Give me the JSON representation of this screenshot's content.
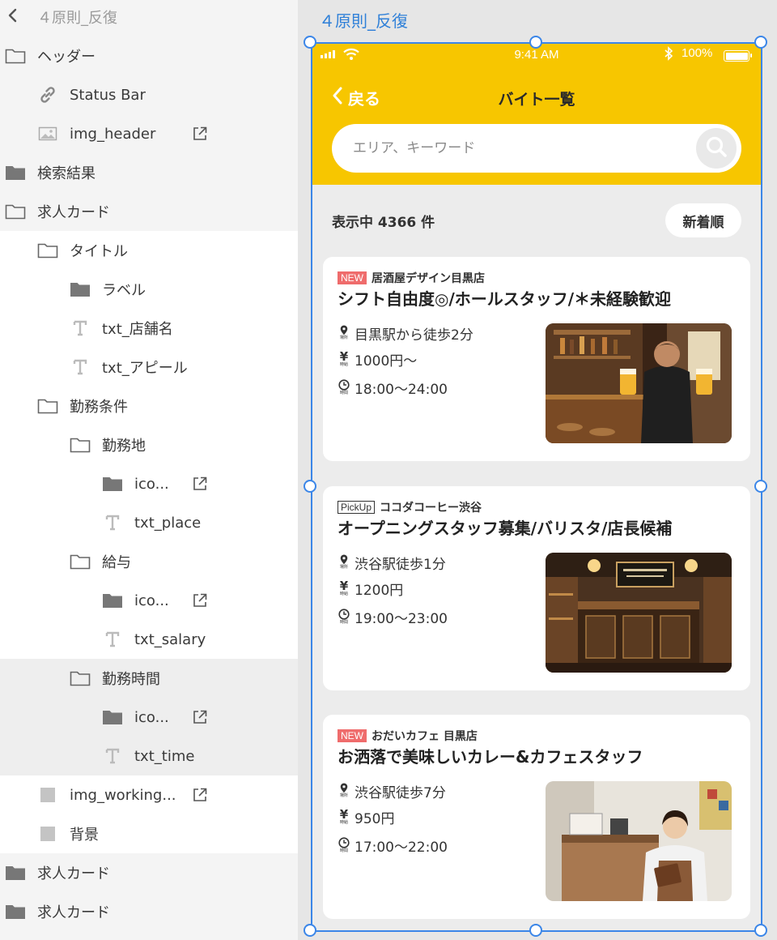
{
  "layers": {
    "back_label": "４原則_反復",
    "items": [
      {
        "label": "ヘッダー",
        "icon": "folder-outline"
      },
      {
        "label": "Status Bar",
        "icon": "link"
      },
      {
        "label": "img_header",
        "icon": "image"
      },
      {
        "label": "検索結果",
        "icon": "folder-filled"
      },
      {
        "label": "求人カード",
        "icon": "folder-outline"
      },
      {
        "label": "タイトル",
        "icon": "folder-outline"
      },
      {
        "label": "ラベル",
        "icon": "folder-filled"
      },
      {
        "label": "txt_店舗名",
        "icon": "text"
      },
      {
        "label": "txt_アピール",
        "icon": "text"
      },
      {
        "label": "勤務条件",
        "icon": "folder-outline"
      },
      {
        "label": "勤務地",
        "icon": "folder-outline"
      },
      {
        "label": "ico...",
        "icon": "folder-filled"
      },
      {
        "label": "txt_place",
        "icon": "text"
      },
      {
        "label": "給与",
        "icon": "folder-outline"
      },
      {
        "label": "ico...",
        "icon": "folder-filled"
      },
      {
        "label": "txt_salary",
        "icon": "text"
      },
      {
        "label": "勤務時間",
        "icon": "folder-outline"
      },
      {
        "label": "ico...",
        "icon": "folder-filled"
      },
      {
        "label": "txt_time",
        "icon": "text"
      },
      {
        "label": "img_working...",
        "icon": "rect"
      },
      {
        "label": "背景",
        "icon": "rect"
      },
      {
        "label": "求人カード",
        "icon": "folder-filled"
      },
      {
        "label": "求人カード",
        "icon": "folder-filled"
      }
    ]
  },
  "canvas": {
    "artboard_title": "４原則_反復"
  },
  "app": {
    "status": {
      "time": "9:41 AM",
      "battery": "100%"
    },
    "nav": {
      "back_label": "戻る",
      "title": "バイト一覧"
    },
    "search": {
      "placeholder": "エリア、キーワード"
    },
    "results_label": "表示中 4366 件",
    "sort_label": "新着順",
    "icon_sub": {
      "place": "場所",
      "salary": "時給",
      "time": "時間"
    },
    "cards": [
      {
        "badge": "NEW",
        "shop": "居酒屋デザイン目黒店",
        "appeal": "シフト自由度◎/ホールスタッフ/＊未経験歓迎",
        "place": "目黒駅から徒歩2分",
        "salary": "1000円〜",
        "time": "18:00〜24:00",
        "photo": "izakaya-staff-photo"
      },
      {
        "badge": "PickUp",
        "shop": "ココダコーヒー渋谷",
        "appeal": "オープニングスタッフ募集/バリスタ/店長候補",
        "place": "渋谷駅徒歩1分",
        "salary": "1200円",
        "time": "19:00〜23:00",
        "photo": "cafe-interior-photo"
      },
      {
        "badge": "NEW",
        "shop": "おだいカフェ 目黒店",
        "appeal": "お洒落で美味しいカレー&カフェスタッフ",
        "place": "渋谷駅徒歩7分",
        "salary": "950円",
        "time": "17:00〜22:00",
        "photo": "cafe-staff-photo"
      }
    ]
  },
  "colors": {
    "header_yellow": "#f7c600",
    "selection_blue": "#3b86e8",
    "badge_new_red": "#ef6c6c"
  }
}
